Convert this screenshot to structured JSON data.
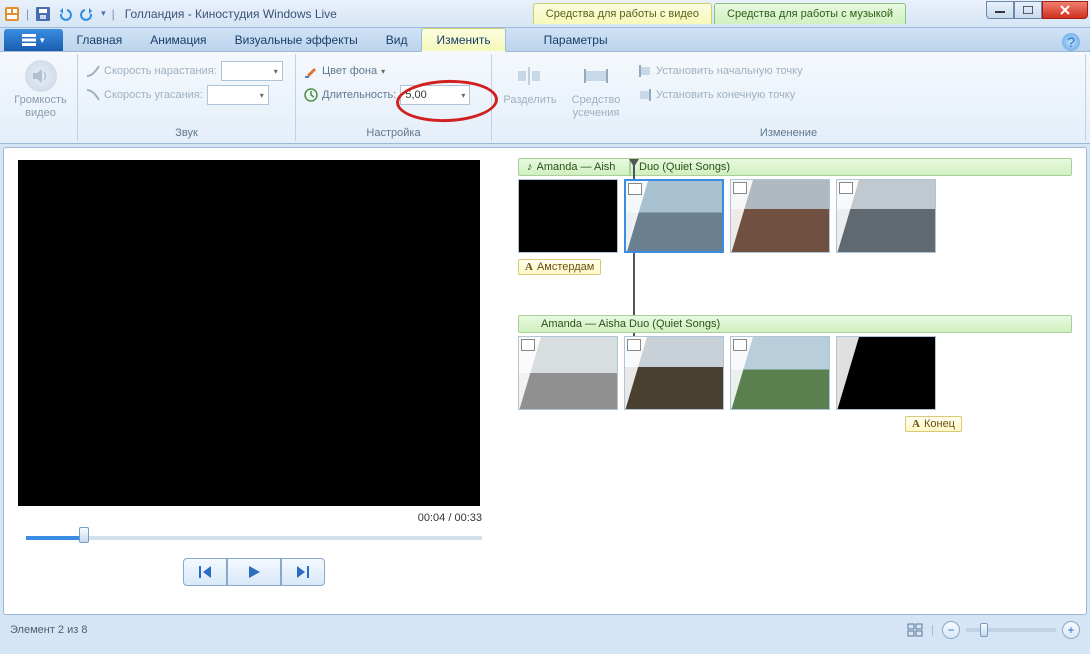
{
  "title": "Голландия - Киностудия Windows Live",
  "context_tabs": {
    "video": "Средства для работы с видео",
    "music": "Средства для работы с музыкой"
  },
  "tabs": {
    "home": "Главная",
    "animation": "Анимация",
    "effects": "Визуальные эффекты",
    "view": "Вид",
    "edit": "Изменить",
    "params": "Параметры"
  },
  "ribbon": {
    "volume": {
      "label": "Громкость\nвидео"
    },
    "sound_group": "Звук",
    "fade_in": "Скорость нарастания:",
    "fade_out": "Скорость угасания:",
    "settings_group": "Настройка",
    "bgcolor": "Цвет фона",
    "duration_label": "Длительность:",
    "duration_value": "5,00",
    "split": "Разделить",
    "trim": "Средство\nусечения",
    "edit_group": "Изменение",
    "set_start": "Установить начальную точку",
    "set_end": "Установить конечную точку"
  },
  "preview": {
    "time": "00:04 / 00:33"
  },
  "storyboard": {
    "music1": "Amanda — Aisha Duo (Quiet Songs)",
    "music1_split_a": "Amanda — Aish",
    "music1_split_b": "Duo (Quiet Songs)",
    "caption_amsterdam": "Амстердам",
    "caption_end": "Конец"
  },
  "status": {
    "item": "Элемент 2 из 8"
  }
}
